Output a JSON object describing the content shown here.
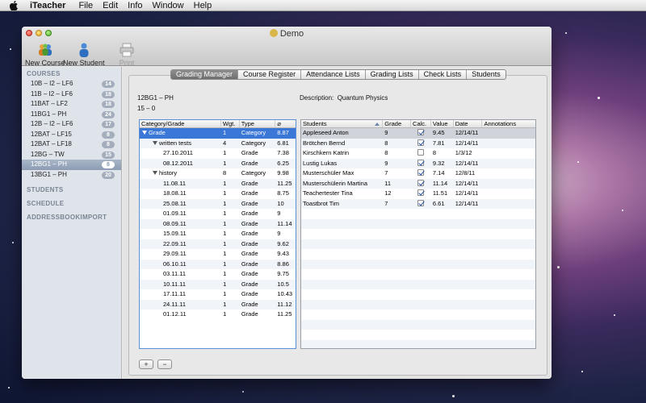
{
  "menubar": {
    "app_name": "iTeacher",
    "items": [
      "File",
      "Edit",
      "Info",
      "Window",
      "Help"
    ]
  },
  "window": {
    "title": "Demo",
    "toolbar": {
      "new_course": "New Course",
      "new_student": "New Student",
      "print": "Print"
    }
  },
  "sidebar": {
    "courses_header": "COURSES",
    "courses": [
      {
        "label": "10B – I2 – LF6",
        "count": "14"
      },
      {
        "label": "11B – I2 – LF6",
        "count": "18"
      },
      {
        "label": "11BAT – LF2",
        "count": "18"
      },
      {
        "label": "11BG1 – PH",
        "count": "24"
      },
      {
        "label": "12B – I2 – LF6",
        "count": "17"
      },
      {
        "label": "12BAT – LF15",
        "count": "8"
      },
      {
        "label": "12BAT – LF18",
        "count": "8"
      },
      {
        "label": "12BG – TW",
        "count": "15"
      },
      {
        "label": "12BG1 – PH",
        "count": "8"
      },
      {
        "label": "13BG1 – PH",
        "count": "20"
      }
    ],
    "selected_index": 8,
    "sections": [
      "STUDENTS",
      "SCHEDULE",
      "ADDRESSBOOKIMPORT"
    ]
  },
  "tabs": {
    "items": [
      "Grading Manager",
      "Course Register",
      "Attendance Lists",
      "Grading Lists",
      "Check Lists",
      "Students"
    ],
    "active_index": 0
  },
  "course_info": {
    "course_name": "12BG1 – PH",
    "grade_range": "15 – 0",
    "description_label": "Description:",
    "description_value": "Quantum Physics"
  },
  "category_table": {
    "columns": [
      "Category/Grade",
      "Wgt.",
      "Type",
      "⌀"
    ],
    "rows": [
      {
        "name": "Grade",
        "indent": 0,
        "expanded": true,
        "weight": "1",
        "type": "Category",
        "avg": "8.87"
      },
      {
        "name": "written tests",
        "indent": 1,
        "expanded": true,
        "weight": "4",
        "type": "Category",
        "avg": "6.81"
      },
      {
        "name": "27.10.2011",
        "indent": 2,
        "expanded": null,
        "weight": "1",
        "type": "Grade",
        "avg": "7.38"
      },
      {
        "name": "08.12.2011",
        "indent": 2,
        "expanded": null,
        "weight": "1",
        "type": "Grade",
        "avg": "6.25"
      },
      {
        "name": "history",
        "indent": 1,
        "expanded": true,
        "weight": "8",
        "type": "Category",
        "avg": "9.98"
      },
      {
        "name": "11.08.11",
        "indent": 2,
        "expanded": null,
        "weight": "1",
        "type": "Grade",
        "avg": "11.25"
      },
      {
        "name": "18.08.11",
        "indent": 2,
        "expanded": null,
        "weight": "1",
        "type": "Grade",
        "avg": "8.75"
      },
      {
        "name": "25.08.11",
        "indent": 2,
        "expanded": null,
        "weight": "1",
        "type": "Grade",
        "avg": "10"
      },
      {
        "name": "01.09.11",
        "indent": 2,
        "expanded": null,
        "weight": "1",
        "type": "Grade",
        "avg": "9"
      },
      {
        "name": "08.09.11",
        "indent": 2,
        "expanded": null,
        "weight": "1",
        "type": "Grade",
        "avg": "11.14"
      },
      {
        "name": "15.09.11",
        "indent": 2,
        "expanded": null,
        "weight": "1",
        "type": "Grade",
        "avg": "9"
      },
      {
        "name": "22.09.11",
        "indent": 2,
        "expanded": null,
        "weight": "1",
        "type": "Grade",
        "avg": "9.62"
      },
      {
        "name": "29.09.11",
        "indent": 2,
        "expanded": null,
        "weight": "1",
        "type": "Grade",
        "avg": "9.43"
      },
      {
        "name": "06.10.11",
        "indent": 2,
        "expanded": null,
        "weight": "1",
        "type": "Grade",
        "avg": "8.86"
      },
      {
        "name": "03.11.11",
        "indent": 2,
        "expanded": null,
        "weight": "1",
        "type": "Grade",
        "avg": "9.75"
      },
      {
        "name": "10.11.11",
        "indent": 2,
        "expanded": null,
        "weight": "1",
        "type": "Grade",
        "avg": "10.5"
      },
      {
        "name": "17.11.11",
        "indent": 2,
        "expanded": null,
        "weight": "1",
        "type": "Grade",
        "avg": "10.43"
      },
      {
        "name": "24.11.11",
        "indent": 2,
        "expanded": null,
        "weight": "1",
        "type": "Grade",
        "avg": "11.12"
      },
      {
        "name": "01.12.11",
        "indent": 2,
        "expanded": null,
        "weight": "1",
        "type": "Grade",
        "avg": "11.25"
      }
    ],
    "selected_index": 0
  },
  "student_table": {
    "columns": [
      "Students",
      "Grade",
      "Calc.",
      "Value",
      "Date",
      "Annotations"
    ],
    "rows": [
      {
        "name": "Appleseed Anton",
        "grade": "9",
        "calc": true,
        "value": "9.45",
        "date": "12/14/11",
        "annotation": ""
      },
      {
        "name": "Brötchen Bernd",
        "grade": "8",
        "calc": true,
        "value": "7.81",
        "date": "12/14/11",
        "annotation": ""
      },
      {
        "name": "Kirschkern Katrin",
        "grade": "8",
        "calc": false,
        "value": "8",
        "date": "1/3/12",
        "annotation": ""
      },
      {
        "name": "Lustig Lukas",
        "grade": "9",
        "calc": true,
        "value": "9.32",
        "date": "12/14/11",
        "annotation": ""
      },
      {
        "name": "Musterschüler Max",
        "grade": "7",
        "calc": true,
        "value": "7.14",
        "date": "12/8/11",
        "annotation": ""
      },
      {
        "name": "Musterschülerin Martina",
        "grade": "11",
        "calc": true,
        "value": "11.14",
        "date": "12/14/11",
        "annotation": ""
      },
      {
        "name": "Teachertester Tina",
        "grade": "12",
        "calc": true,
        "value": "11.51",
        "date": "12/14/11",
        "annotation": ""
      },
      {
        "name": "Toastbrot Tim",
        "grade": "7",
        "calc": true,
        "value": "6.61",
        "date": "12/14/11",
        "annotation": ""
      }
    ],
    "selected_index": 0,
    "empty_rows": 15
  },
  "buttons": {
    "add": "+",
    "remove": "−"
  },
  "icons": {
    "apple": "apple-icon",
    "new_course": "new-course-icon",
    "new_student": "new-student-icon",
    "print": "printer-icon"
  },
  "colors": {
    "selection": "#3a77d7",
    "sidebar": "#dee4ea",
    "badge": "#a3adbc"
  }
}
